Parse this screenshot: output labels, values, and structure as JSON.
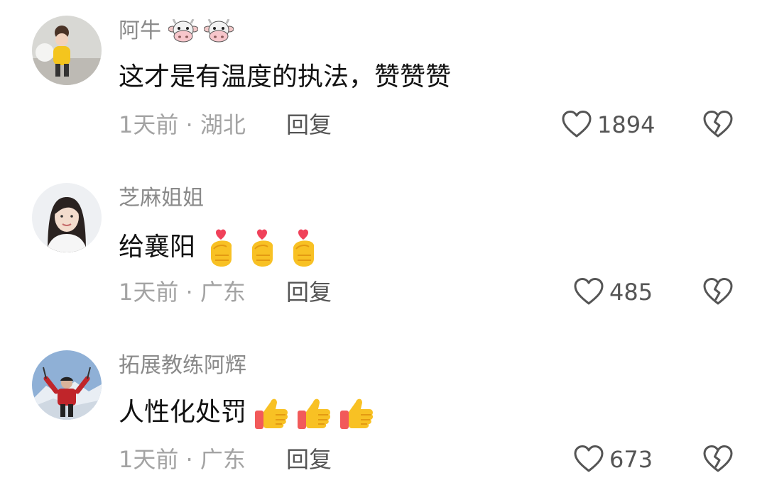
{
  "comments": [
    {
      "username": "阿牛",
      "username_emoji": [
        "cow-face-icon",
        "cow-face-icon"
      ],
      "content": "这才是有温度的执法，赞赞赞",
      "content_emoji": [],
      "meta": "1天前 · 湖北",
      "reply_label": "回复",
      "like_count": "1894",
      "avatar": "avatar-girl-yellow-shirt"
    },
    {
      "username": "芝麻姐姐",
      "username_emoji": [],
      "content": "给襄阳",
      "content_emoji": [
        "finger-heart-icon",
        "finger-heart-icon",
        "finger-heart-icon"
      ],
      "meta": "1天前 · 广东",
      "reply_label": "回复",
      "like_count": "485",
      "avatar": "avatar-woman-portrait"
    },
    {
      "username": "拓展教练阿辉",
      "username_emoji": [],
      "content": "人性化处罚",
      "content_emoji": [
        "thumbs-up-icon",
        "thumbs-up-icon",
        "thumbs-up-icon"
      ],
      "meta": "1天前 · 广东",
      "reply_label": "回复",
      "like_count": "673",
      "avatar": "avatar-man-mountain"
    }
  ],
  "icons": {
    "like": "heart-outline-icon",
    "dislike": "broken-heart-outline-icon"
  },
  "colors": {
    "username": "#8a8a8a",
    "content": "#111111",
    "meta": "#a3a3a3",
    "action": "#555555",
    "icon_stroke": "#555555"
  }
}
